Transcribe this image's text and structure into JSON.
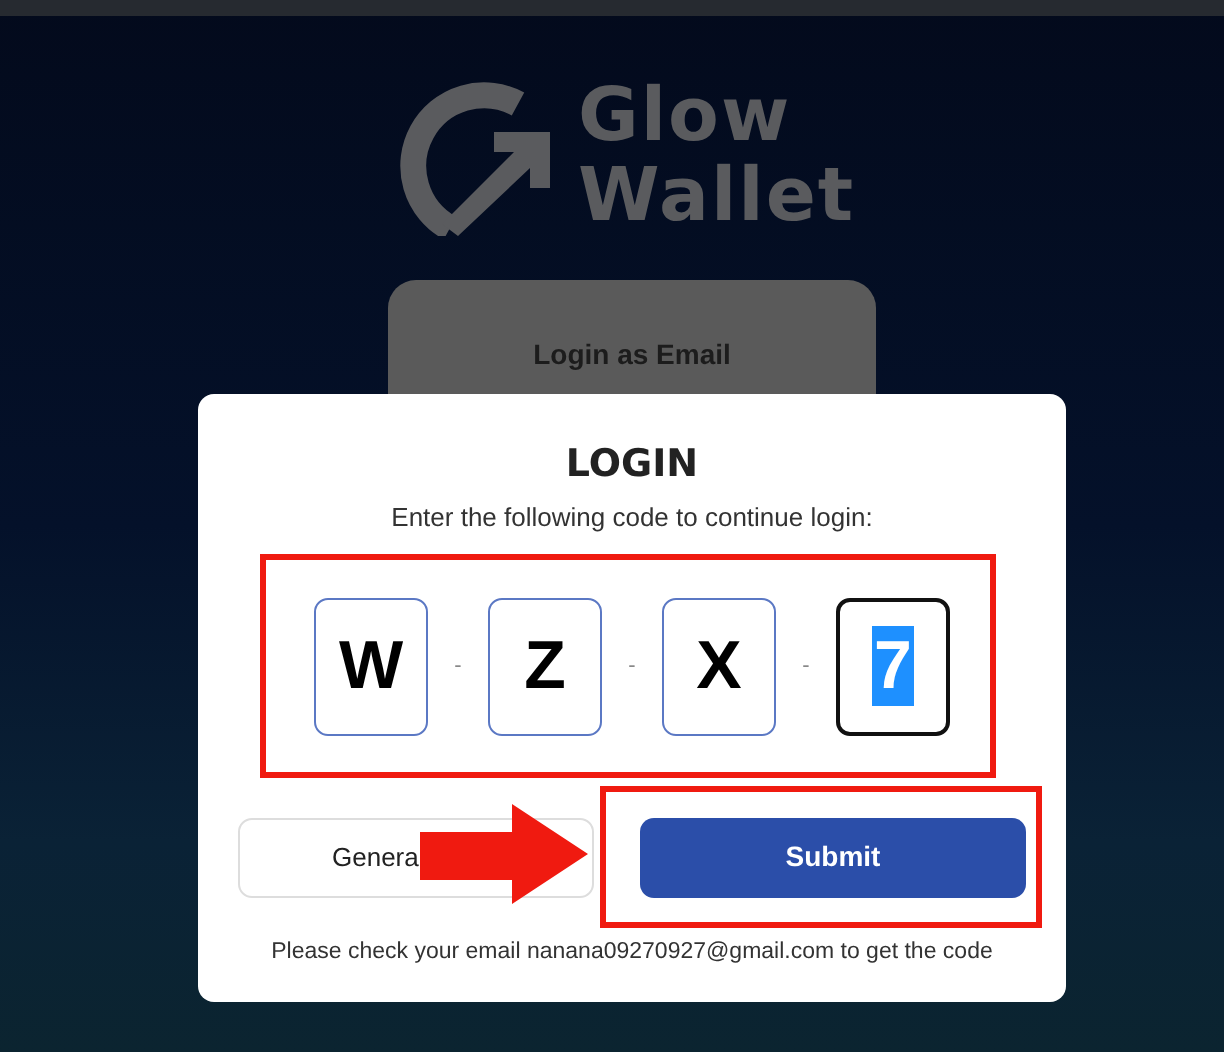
{
  "logo": {
    "line_1": "Glow",
    "line_2": "Wallet"
  },
  "background_card": {
    "label": "Login as Email"
  },
  "dialog": {
    "title": "LOGIN",
    "instruction": "Enter the following code to continue login:",
    "code": [
      {
        "char": "W",
        "focused": false
      },
      {
        "char": "Z",
        "focused": false
      },
      {
        "char": "X",
        "focused": false
      },
      {
        "char": "7",
        "focused": true
      }
    ],
    "separators": [
      "-",
      "-",
      "-"
    ],
    "buttons": [
      {
        "label": "Genera",
        "kind": "secondary"
      },
      {
        "label": "Submit",
        "kind": "primary"
      }
    ],
    "note": "Please check your email nanana09270927@gmail.com to get the code"
  },
  "annotations": [
    {
      "kind": "box"
    },
    {
      "kind": "box"
    },
    {
      "kind": "arrow"
    }
  ]
}
